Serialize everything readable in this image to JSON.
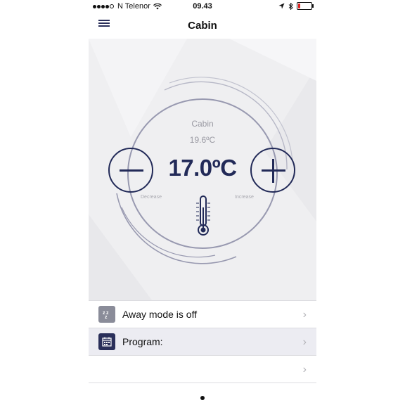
{
  "status_bar": {
    "carrier": "N Telenor",
    "time": "09.43",
    "icons": [
      "signal-dots-icon",
      "wifi-icon",
      "location-icon",
      "bluetooth-icon",
      "battery-low-icon"
    ],
    "battery_color": "#e02020"
  },
  "navbar": {
    "title": "Cabin",
    "menu_icon": "hamburger-menu-icon"
  },
  "thermostat": {
    "room_name": "Cabin",
    "current_temperature": "19.6ºC",
    "setpoint": "17.0ºC",
    "decrease_label": "Decrease",
    "increase_label": "Increase",
    "accent_color": "#222a58"
  },
  "list": {
    "items": [
      {
        "label": "Away mode is off",
        "icon": "sleep-zz-icon"
      },
      {
        "label": "Program:",
        "icon": "calendar-icon"
      },
      {
        "label": "",
        "icon": ""
      }
    ]
  },
  "pager": {
    "pages": 1,
    "current": 1
  }
}
